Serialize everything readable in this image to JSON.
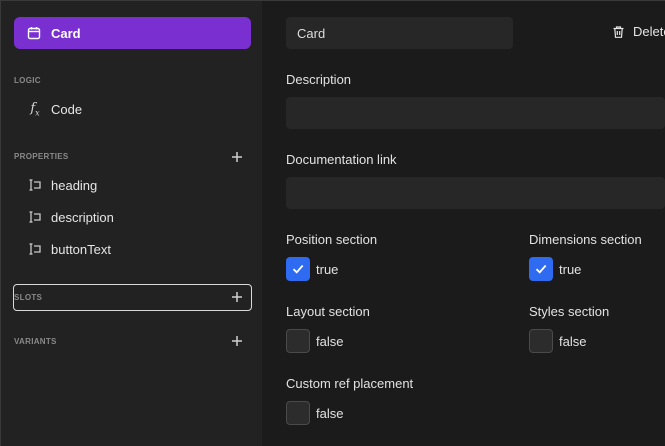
{
  "sidebar": {
    "component": {
      "label": "Card",
      "icon": "calendar-card-icon",
      "accent": "#7a2fd1"
    },
    "logic": {
      "title": "LOGIC",
      "items": [
        {
          "label": "Code",
          "icon": "function-icon"
        }
      ]
    },
    "properties": {
      "title": "PROPERTIES",
      "items": [
        {
          "label": "heading",
          "icon": "text-prop-icon"
        },
        {
          "label": "description",
          "icon": "text-prop-icon"
        },
        {
          "label": "buttonText",
          "icon": "text-prop-icon"
        }
      ]
    },
    "slots": {
      "title": "SLOTS"
    },
    "variants": {
      "title": "VARIANTS"
    }
  },
  "main": {
    "name_input": {
      "value": "Card"
    },
    "delete_label": "Delete",
    "description": {
      "label": "Description",
      "value": ""
    },
    "doc_link": {
      "label": "Documentation link",
      "value": ""
    },
    "options": [
      {
        "label": "Position section",
        "checked": true,
        "value_text": "true"
      },
      {
        "label": "Dimensions section",
        "checked": true,
        "value_text": "true"
      },
      {
        "label": "Layout section",
        "checked": false,
        "value_text": "false"
      },
      {
        "label": "Styles section",
        "checked": false,
        "value_text": "false"
      },
      {
        "label": "Custom ref placement",
        "checked": false,
        "value_text": "false"
      }
    ],
    "checkbox_accent": "#2f6bf0"
  }
}
